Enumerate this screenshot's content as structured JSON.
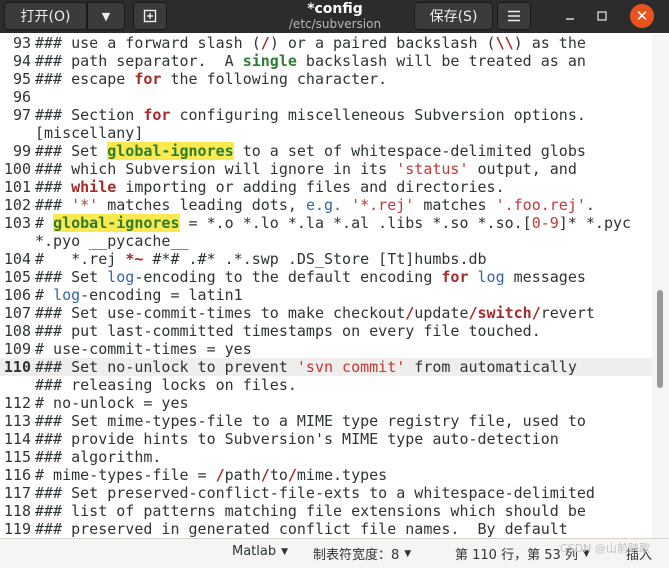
{
  "toolbar": {
    "open_label": "打开(O)",
    "save_label": "保存(S)"
  },
  "title": {
    "name": "*config",
    "path": "/etc/subversion"
  },
  "lines": [
    {
      "n": "93",
      "segs": [
        [
          "### use a forward slash (",
          ""
        ],
        [
          "/",
          "kw"
        ],
        [
          ") or a paired backslash (",
          ""
        ],
        [
          "\\\\",
          "kw"
        ],
        [
          ") as the",
          ""
        ]
      ]
    },
    {
      "n": "94",
      "segs": [
        [
          "### path separator.  A ",
          ""
        ],
        [
          "single",
          "gr"
        ],
        [
          " backslash will be treated as an",
          ""
        ]
      ]
    },
    {
      "n": "95",
      "segs": [
        [
          "### escape ",
          ""
        ],
        [
          "for",
          "kw"
        ],
        [
          " the following character.",
          ""
        ]
      ]
    },
    {
      "n": "96",
      "segs": []
    },
    {
      "n": "97",
      "segs": [
        [
          "### Section ",
          ""
        ],
        [
          "for",
          "kw"
        ],
        [
          " configuring miscelleneous Subversion options.",
          ""
        ]
      ]
    },
    {
      "n": "",
      "segs": [
        [
          "[miscellany]",
          ""
        ]
      ]
    },
    {
      "n": "99",
      "segs": [
        [
          "### Set ",
          ""
        ],
        [
          "global-ignores",
          "hl"
        ],
        [
          " to a set of whitespace-delimited globs",
          ""
        ]
      ]
    },
    {
      "n": "100",
      "segs": [
        [
          "### which Subversion will ignore in its ",
          ""
        ],
        [
          "'status'",
          "str"
        ],
        [
          " output, and",
          ""
        ]
      ]
    },
    {
      "n": "101",
      "segs": [
        [
          "### ",
          ""
        ],
        [
          "while",
          "kw"
        ],
        [
          " importing or adding files and directories.",
          ""
        ]
      ]
    },
    {
      "n": "102",
      "segs": [
        [
          "### ",
          ""
        ],
        [
          "'*'",
          "str"
        ],
        [
          " matches leading dots, ",
          ""
        ],
        [
          "e.g.",
          "fn"
        ],
        [
          " ",
          ""
        ],
        [
          "'*.rej'",
          "str"
        ],
        [
          " matches ",
          ""
        ],
        [
          "'.foo.rej'",
          "str"
        ],
        [
          ".",
          ""
        ]
      ]
    },
    {
      "n": "103",
      "segs": [
        [
          "# ",
          ""
        ],
        [
          "global-ignores",
          "hl"
        ],
        [
          " = *.o *.lo *.la *.al .libs *.so *.so.[",
          ""
        ],
        [
          "0-9",
          "str"
        ],
        [
          "]* *.pyc",
          ""
        ]
      ]
    },
    {
      "n": "",
      "segs": [
        [
          "*.pyo __pycache__",
          ""
        ]
      ]
    },
    {
      "n": "104",
      "segs": [
        [
          "#   *.rej ",
          ""
        ],
        [
          "*~",
          "kw"
        ],
        [
          " #*# .#* .*.swp .DS_Store [Tt]humbs.db",
          ""
        ]
      ]
    },
    {
      "n": "105",
      "segs": [
        [
          "### Set ",
          ""
        ],
        [
          "log",
          "fn"
        ],
        [
          "-encoding to the default encoding ",
          ""
        ],
        [
          "for",
          "kw"
        ],
        [
          " ",
          ""
        ],
        [
          "log",
          "fn"
        ],
        [
          " messages",
          ""
        ]
      ]
    },
    {
      "n": "106",
      "segs": [
        [
          "# ",
          ""
        ],
        [
          "log",
          "fn"
        ],
        [
          "-encoding = latin1",
          ""
        ]
      ]
    },
    {
      "n": "107",
      "segs": [
        [
          "### Set use-commit-times to make checkout",
          ""
        ],
        [
          "/",
          "kw"
        ],
        [
          "update",
          ""
        ],
        [
          "/",
          "kw"
        ],
        [
          "switch",
          "kw"
        ],
        [
          "/",
          "kw"
        ],
        [
          "revert",
          ""
        ]
      ]
    },
    {
      "n": "108",
      "segs": [
        [
          "### put last-committed timestamps on every file touched.",
          ""
        ]
      ]
    },
    {
      "n": "109",
      "segs": [
        [
          "# use-commit-times = yes",
          ""
        ]
      ]
    },
    {
      "n": "110",
      "cur": true,
      "segs": [
        [
          "### Set no-unlock to prevent ",
          ""
        ],
        [
          "'svn commit'",
          "str"
        ],
        [
          " from automatically",
          ""
        ]
      ]
    },
    {
      "n": "",
      "segs": [
        [
          "### releasing locks on files.",
          ""
        ]
      ]
    },
    {
      "n": "112",
      "segs": [
        [
          "# no-unlock = yes",
          ""
        ]
      ]
    },
    {
      "n": "113",
      "segs": [
        [
          "### Set mime-types-file to a MIME type registry file, used to",
          ""
        ]
      ]
    },
    {
      "n": "114",
      "segs": [
        [
          "### provide hints to Subversion's MIME type auto-detection",
          ""
        ]
      ]
    },
    {
      "n": "115",
      "segs": [
        [
          "### algorithm.",
          ""
        ]
      ]
    },
    {
      "n": "116",
      "segs": [
        [
          "# mime-types-file = ",
          ""
        ],
        [
          "/",
          "kw"
        ],
        [
          "path",
          ""
        ],
        [
          "/",
          "kw"
        ],
        [
          "to",
          ""
        ],
        [
          "/",
          "kw"
        ],
        [
          "mime.types",
          ""
        ]
      ]
    },
    {
      "n": "117",
      "segs": [
        [
          "### Set preserved-conflict-file-exts to a whitespace-delimited",
          ""
        ]
      ]
    },
    {
      "n": "118",
      "segs": [
        [
          "### list of patterns matching file extensions which should be",
          ""
        ]
      ]
    },
    {
      "n": "119",
      "segs": [
        [
          "### preserved in generated conflict file names.  By default",
          ""
        ]
      ]
    }
  ],
  "status": {
    "language": "Matlab",
    "tab_width": "制表符宽度：8",
    "position": "第 110 行，第 53 列",
    "mode": "插入"
  },
  "watermark": "CSDN @山前踏歌"
}
